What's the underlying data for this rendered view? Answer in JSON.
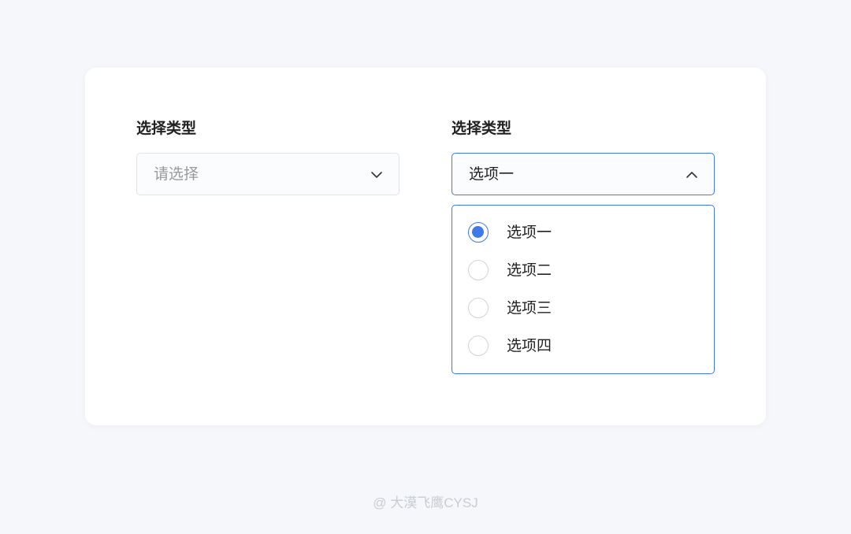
{
  "colors": {
    "page_background": "#f5f7fa",
    "accent": "#3e7be6",
    "border": "#e1e5eb",
    "placeholder": "#999999",
    "text": "#222222"
  },
  "form": {
    "left_field": {
      "label": "选择类型",
      "placeholder": "请选择",
      "icon": "chevron-down-icon"
    },
    "right_field": {
      "label": "选择类型",
      "selected_value": "选项一",
      "icon": "chevron-up-icon",
      "options": [
        {
          "label": "选项一",
          "checked": true
        },
        {
          "label": "选项二",
          "checked": false
        },
        {
          "label": "选项三",
          "checked": false
        },
        {
          "label": "选项四",
          "checked": false
        }
      ]
    }
  },
  "watermark": "@ 大漠飞鹰CYSJ"
}
